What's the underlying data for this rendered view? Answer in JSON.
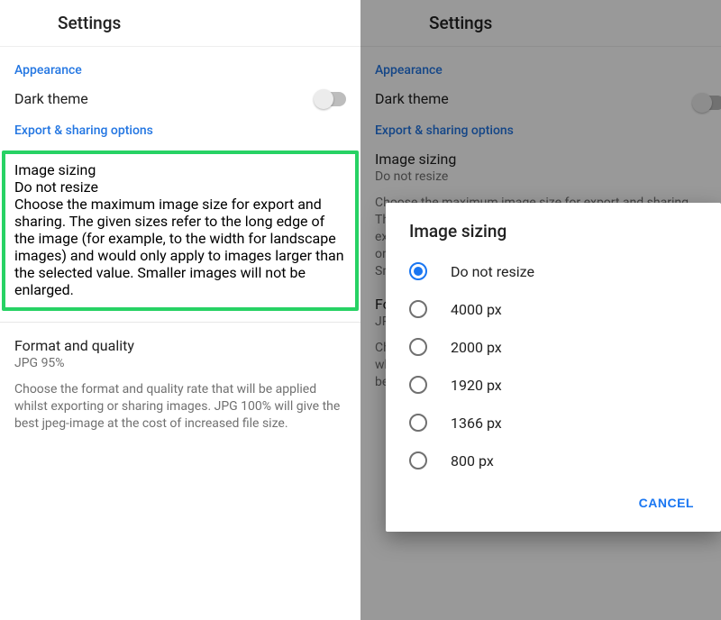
{
  "header": {
    "title": "Settings"
  },
  "sections": {
    "appearance": {
      "label": "Appearance",
      "dark_theme_label": "Dark theme"
    },
    "export": {
      "label": "Export & sharing options",
      "image_sizing": {
        "title": "Image sizing",
        "value": "Do not resize",
        "desc": "Choose the maximum image size for export and sharing. The given sizes refer to the long edge of the image (for example, to the width for landscape images) and would only apply to images larger than the selected value. Smaller images will not be enlarged."
      },
      "format": {
        "title": "Format and quality",
        "value": "JPG 95%",
        "desc": "Choose the format and quality rate that will be applied whilst exporting or sharing images. JPG 100% will give the best jpeg-image at the cost of increased file size."
      }
    }
  },
  "dialog": {
    "title": "Image sizing",
    "options": {
      "o0": "Do not resize",
      "o1": "4000 px",
      "o2": "2000 px",
      "o3": "1920 px",
      "o4": "1366 px",
      "o5": "800 px"
    },
    "selected": "o0",
    "cancel": "CANCEL"
  }
}
